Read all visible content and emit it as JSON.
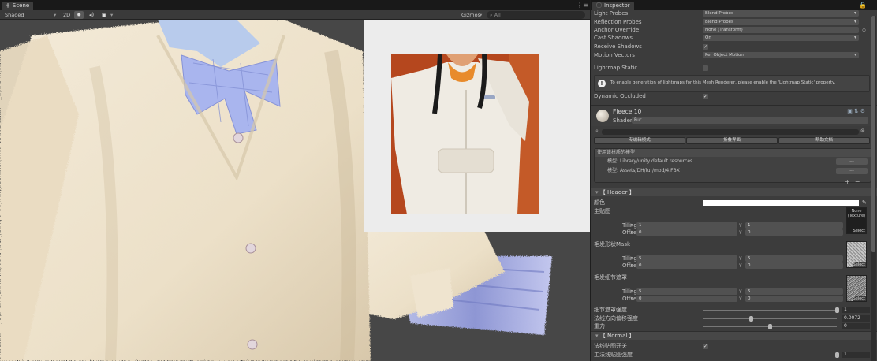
{
  "scene": {
    "tab_label": "Scene",
    "tab_icon": "hash-grid-icon",
    "shading_mode": "Shaded",
    "mode_2d": "2D",
    "gizmos_label": "Gizmos",
    "search_placeholder": "All"
  },
  "inspector": {
    "tab_label": "Inspector",
    "rows": [
      {
        "label": "Light Probes",
        "value": "Blend Probes"
      },
      {
        "label": "Reflection Probes",
        "value": "Blend Probes"
      },
      {
        "label": "Anchor Override",
        "value": "None (Transform)"
      },
      {
        "label": "Cast Shadows",
        "value": "On"
      },
      {
        "label": "Receive Shadows",
        "checked": "✓"
      },
      {
        "label": "Motion Vectors",
        "value": "Per Object Motion"
      },
      {
        "label": "Lightmap Static",
        "checked": ""
      }
    ],
    "lightmap_help": "To enable generation of lightmaps for this Mesh Renderer, please enable the 'Lightmap Static' property.",
    "dynamic_occluded": {
      "label": "Dynamic Occluded",
      "checked": "✓"
    },
    "material": {
      "name": "Fleece 10",
      "shader_label": "Shader",
      "shader_value": "Fur"
    },
    "toolbar_buttons": [
      "专编辑模式",
      "折叠界面",
      "帮助文档"
    ],
    "usage_box": {
      "title": "使用该材质的模型",
      "items": [
        {
          "prefix": "模型:",
          "path": "Library/unity default resources"
        },
        {
          "prefix": "模型:",
          "path": "Assets/DH/fur/mod/4.FBX"
        }
      ],
      "dots": "...",
      "add": "+",
      "remove": "−"
    },
    "header_section": "【 Header 】",
    "main_color_label": "颜色",
    "main_tex": {
      "label": "主贴图",
      "thumb_text": "None (Texture)",
      "select": "Select",
      "tiling": {
        "x": "1",
        "y": "1"
      },
      "offset": {
        "x": "0",
        "y": "0"
      }
    },
    "fur_mask": {
      "label": "毛发形状Mask",
      "select": "Select",
      "tiling": {
        "x": "5",
        "y": "5"
      },
      "offset": {
        "x": "0",
        "y": "0"
      }
    },
    "fur_detail": {
      "label": "毛发细节遮罩",
      "select": "Select",
      "tiling": {
        "x": "5",
        "y": "5"
      },
      "offset": {
        "x": "0",
        "y": "0"
      }
    },
    "tiling_label": "Tiling",
    "offset_label": "Offset",
    "x_label": "X",
    "y_label": "Y",
    "sliders": [
      {
        "label": "细节遮罩强度",
        "value": "1",
        "fraction": 1.0
      },
      {
        "label": "法线方向偏移强度",
        "value": "0.0072",
        "fraction": 0.36
      },
      {
        "label": "重力",
        "value": "0",
        "fraction": 0.5
      }
    ],
    "normal_section": "【 Normal 】",
    "normal_toggle": {
      "label": "法线贴图开关",
      "checked": "✓"
    },
    "normal_strength": {
      "label": "主法线贴图强度",
      "value": "1",
      "fraction": 1.0
    }
  },
  "colors": {
    "accent_swatch": "#ffffff",
    "panel_bg": "#3c3c3c"
  }
}
